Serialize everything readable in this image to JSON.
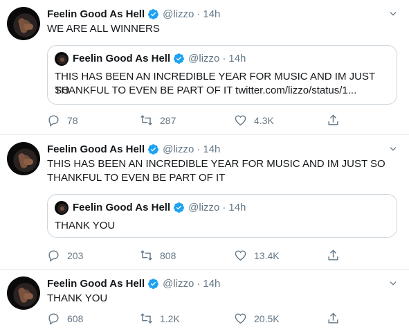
{
  "tweets": [
    {
      "name": "Feelin Good As Hell",
      "handle": "@lizzo",
      "dot": "·",
      "time": "14h",
      "text": "WE ARE ALL WINNERS",
      "quote": {
        "name": "Feelin Good As Hell",
        "handle": "@lizzo",
        "dot": "·",
        "time": "14h",
        "text_line1": "THIS HAS BEEN AN INCREDIBLE YEAR FOR MUSIC AND IM JUST SO",
        "text_line2": "THANKFUL TO EVEN BE PART OF IT twitter.com/lizzo/status/1..."
      },
      "replies": "78",
      "retweets": "287",
      "likes": "4.3K"
    },
    {
      "name": "Feelin Good As Hell",
      "handle": "@lizzo",
      "dot": "·",
      "time": "14h",
      "text_line1": "THIS HAS BEEN AN INCREDIBLE YEAR FOR MUSIC AND IM JUST SO",
      "text_line2": "THANKFUL TO EVEN BE PART OF IT",
      "quote": {
        "name": "Feelin Good As Hell",
        "handle": "@lizzo",
        "dot": "·",
        "time": "14h",
        "text_line1": "THANK YOU"
      },
      "replies": "203",
      "retweets": "808",
      "likes": "13.4K"
    },
    {
      "name": "Feelin Good As Hell",
      "handle": "@lizzo",
      "dot": "·",
      "time": "14h",
      "text": "THANK YOU",
      "replies": "608",
      "retweets": "1.2K",
      "likes": "20.5K"
    }
  ],
  "colors": {
    "verified": "#1da1f2",
    "secondary_text": "#657786",
    "divider": "#e6ecf0"
  },
  "icons": [
    "verified-badge-icon",
    "chevron-down-icon",
    "reply-icon",
    "retweet-icon",
    "like-icon",
    "share-icon"
  ]
}
